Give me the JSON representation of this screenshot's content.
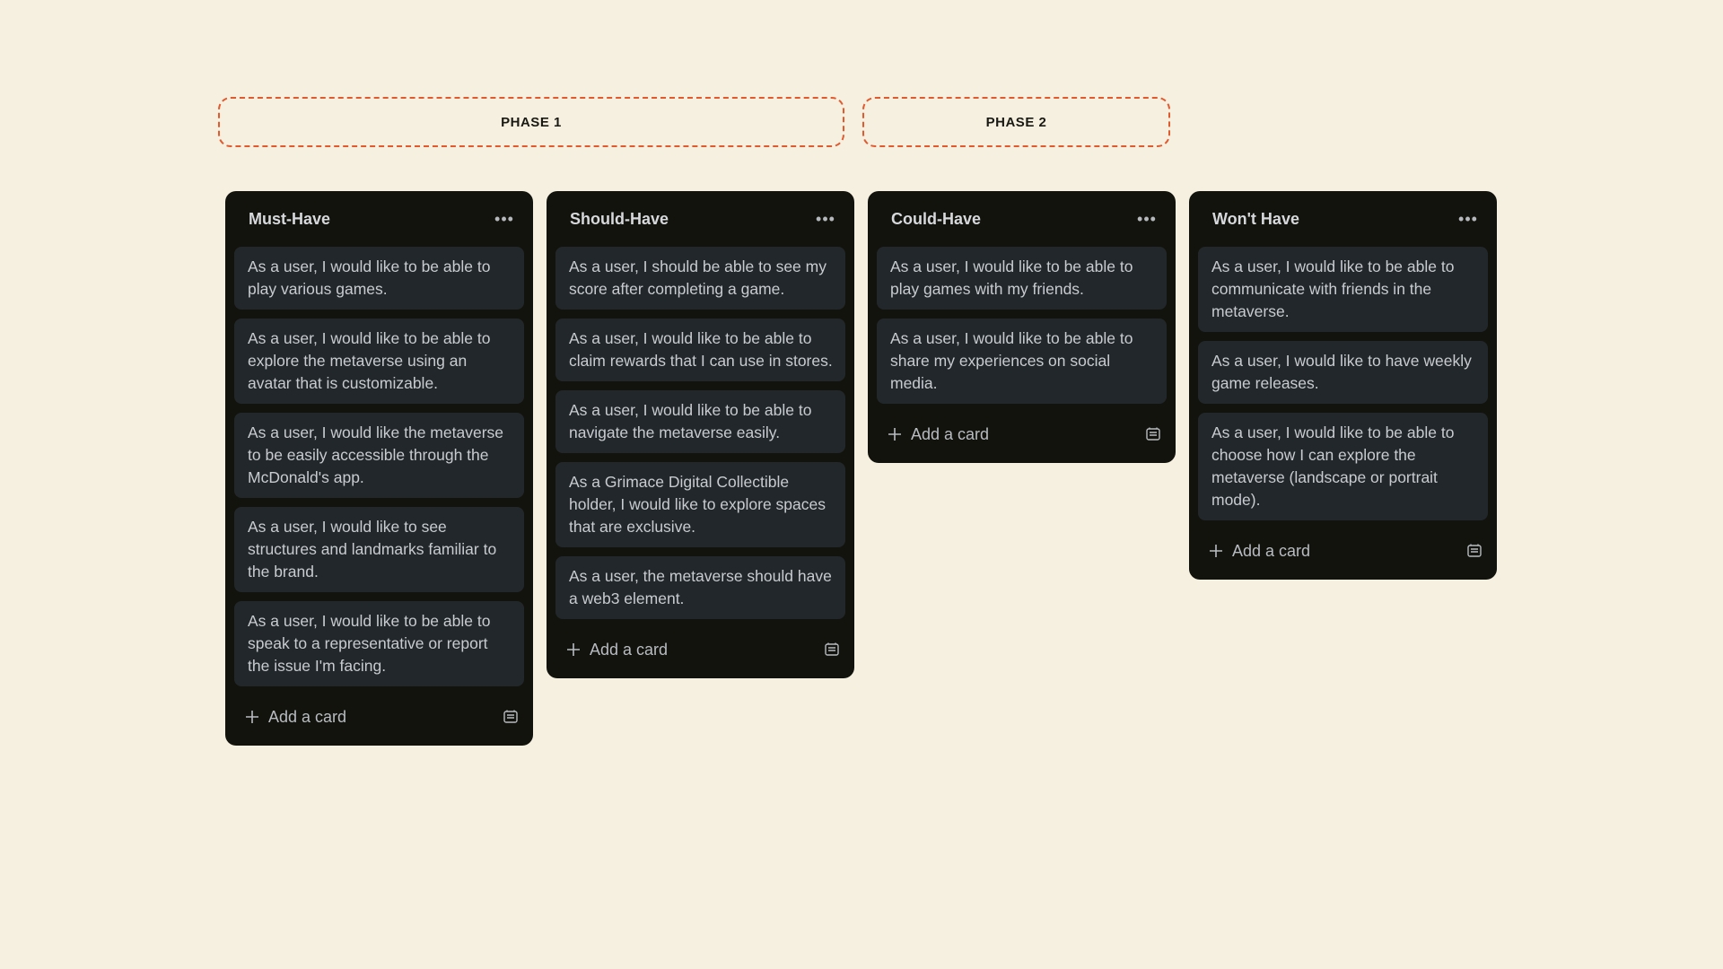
{
  "phases": [
    {
      "label": "PHASE 1"
    },
    {
      "label": "PHASE 2"
    }
  ],
  "lists": [
    {
      "title": "Must-Have",
      "more_icon": "ellipsis-icon",
      "cards": [
        "As a user, I would like to be able to play various games.",
        "As a user, I would like to be able to explore the metaverse using an avatar that is customizable.",
        "As a user, I would like the metaverse to be easily accessible through the McDonald's app.",
        "As a user, I would like to see structures and landmarks familiar to the brand.",
        "As a user, I would like to be able to speak to a representative or report the issue I'm facing."
      ],
      "add_label": "Add a card"
    },
    {
      "title": "Should-Have",
      "more_icon": "ellipsis-icon",
      "cards": [
        "As a user, I should be able to see my score after completing a game.",
        "As a user, I would like to be able to claim rewards that I can use in stores.",
        "As a user, I would like to be able to navigate the metaverse easily.",
        "As a Grimace Digital Collectible holder, I would like to explore spaces that are exclusive.",
        "As a user, the metaverse should have a web3 element."
      ],
      "add_label": "Add a card"
    },
    {
      "title": "Could-Have",
      "more_icon": "ellipsis-icon",
      "cards": [
        "As a user, I would like to be able to play games with my friends.",
        "As a user, I would like to be able to share my experiences on social media."
      ],
      "add_label": "Add a card"
    },
    {
      "title": "Won't Have",
      "more_icon": "ellipsis-icon",
      "cards": [
        "As a user, I would like to be able to communicate with friends in the metaverse.",
        "As a user, I would like to have weekly game releases.",
        "As a user, I would like to be able to choose how I can explore the metaverse (landscape or portrait mode)."
      ],
      "add_label": "Add a card"
    }
  ],
  "colors": {
    "background": "#f5f0e0",
    "phase_border": "#e2592e",
    "list_bg": "#12130c",
    "card_bg": "#22272b",
    "card_text": "#c8ccd1"
  }
}
